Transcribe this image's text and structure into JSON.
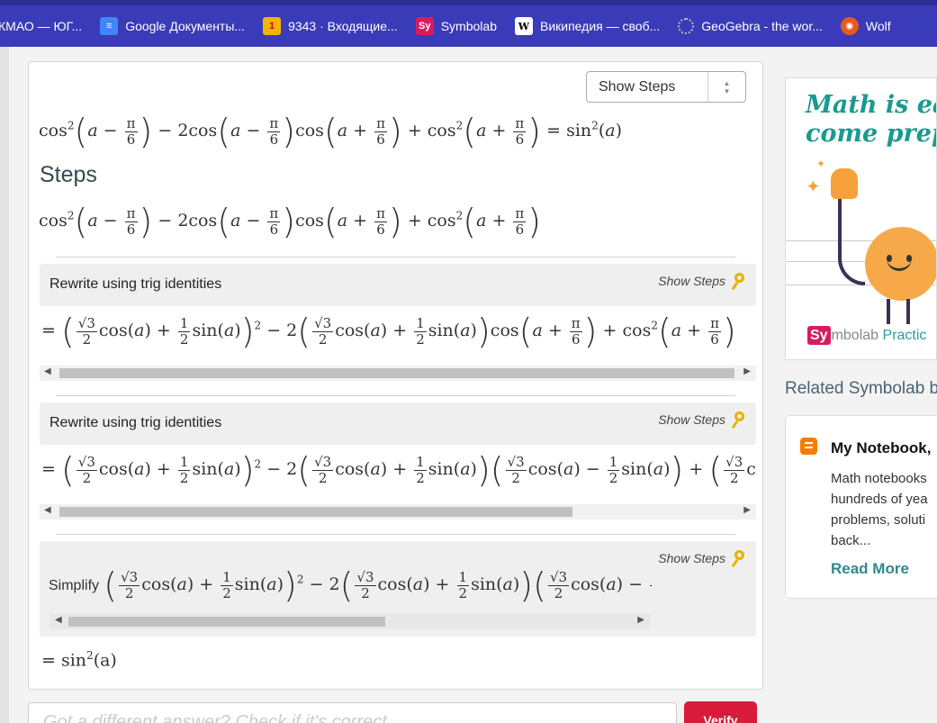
{
  "bookmarks": [
    {
      "label": "КМАО — ЮГ...",
      "icon": "yugra-icon"
    },
    {
      "label": "Google Документы...",
      "icon": "google-docs-icon"
    },
    {
      "label": "9343 · Входящие...",
      "icon": "mail-icon",
      "badge": "1"
    },
    {
      "label": "Symbolab",
      "icon": "symbolab-icon",
      "glyph": "Sy"
    },
    {
      "label": "Википедия — своб...",
      "icon": "wikipedia-icon",
      "glyph": "W"
    },
    {
      "label": "GeoGebra - the wor...",
      "icon": "geogebra-icon"
    },
    {
      "label": "Wolf",
      "icon": "wolfram-icon"
    }
  ],
  "solution": {
    "mode_select": "Show Steps",
    "steps_title": "Steps",
    "steps": [
      {
        "label": "Rewrite using trig identities",
        "show_steps": "Show Steps"
      },
      {
        "label": "Rewrite using trig identities",
        "show_steps": "Show Steps"
      },
      {
        "label": "Simplify",
        "show_steps": "Show Steps"
      }
    ],
    "equals_sign": "=",
    "result": "sin",
    "result_power": "2",
    "result_arg": "(a)"
  },
  "answer": {
    "placeholder": "Got a different answer? Check if it's correct",
    "verify_label": "Verify"
  },
  "ad": {
    "headline_line1": "Math is eas",
    "headline_line2": "come prepa",
    "brand_sy": "Sy",
    "brand_rest": "mbolab",
    "brand_practice": "Practic"
  },
  "related": {
    "heading": "Related Symbolab b",
    "blog_title": "My Notebook,",
    "blog_desc": "Math notebooks hundreds of yea problems, soluti back...",
    "read_more": "Read More"
  }
}
